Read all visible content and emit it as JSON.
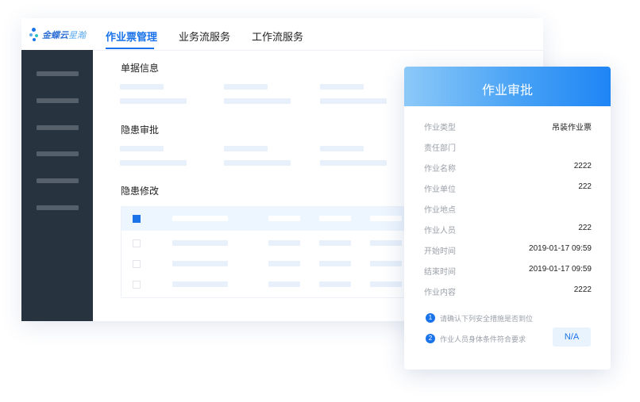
{
  "app": {
    "logo": {
      "brand": "金蝶云",
      "product": "星瀚"
    },
    "tabs": [
      {
        "label": "作业票管理",
        "active": true
      },
      {
        "label": "业务流服务",
        "active": false
      },
      {
        "label": "工作流服务",
        "active": false
      }
    ],
    "sections": [
      "单据信息",
      "隐患审批",
      "隐患修改"
    ]
  },
  "card": {
    "title": "作业审批",
    "rows": [
      {
        "label": "作业类型",
        "value": "吊装作业票"
      },
      {
        "label": "责任部门",
        "value": ""
      },
      {
        "label": "作业名称",
        "value": "2222"
      },
      {
        "label": "作业单位",
        "value": "222"
      },
      {
        "label": "作业地点",
        "value": ""
      },
      {
        "label": "作业人员",
        "value": "222"
      },
      {
        "label": "开始时间",
        "value": "2019-01-17 09:59"
      },
      {
        "label": "结束时间",
        "value": "2019-01-17 09:59"
      },
      {
        "label": "作业内容",
        "value": "2222"
      }
    ],
    "confirmations": [
      {
        "num": "1",
        "text": "请确认下列安全措施是否到位"
      },
      {
        "num": "2",
        "text": "作业人员身体条件符合要求"
      }
    ],
    "na_button": "N/A"
  },
  "colors": {
    "accent": "#1a73e8",
    "sidebar": "#27333f",
    "placeholder": "#e8f0fb"
  }
}
